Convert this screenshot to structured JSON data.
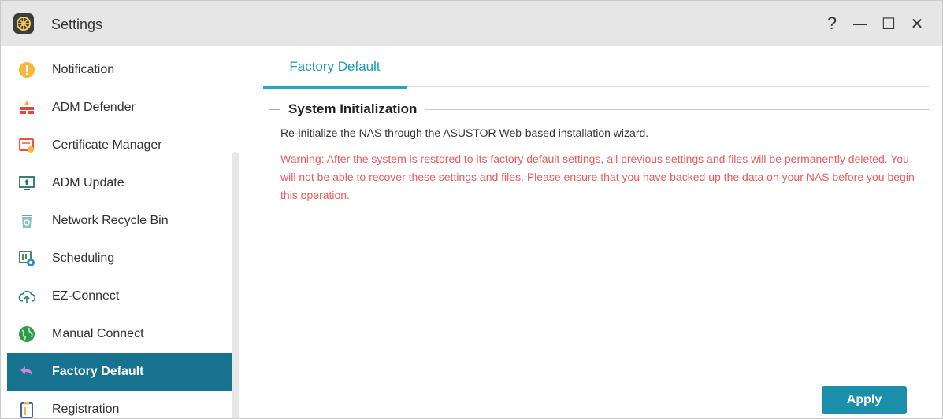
{
  "window": {
    "title": "Settings",
    "help_glyph": "?",
    "minimize_glyph": "—",
    "maximize_glyph": "☐",
    "close_glyph": "✕"
  },
  "sidebar": {
    "items": [
      {
        "label": "Notification",
        "icon": "exclamation-circle-icon",
        "active": false
      },
      {
        "label": "ADM Defender",
        "icon": "firewall-icon",
        "active": false
      },
      {
        "label": "Certificate Manager",
        "icon": "certificate-icon",
        "active": false
      },
      {
        "label": "ADM Update",
        "icon": "monitor-update-icon",
        "active": false
      },
      {
        "label": "Network Recycle Bin",
        "icon": "recycle-bin-icon",
        "active": false
      },
      {
        "label": "Scheduling",
        "icon": "scheduling-icon",
        "active": false
      },
      {
        "label": "EZ-Connect",
        "icon": "cloud-upload-icon",
        "active": false
      },
      {
        "label": "Manual Connect",
        "icon": "globe-icon",
        "active": false
      },
      {
        "label": "Factory Default",
        "icon": "undo-arrow-icon",
        "active": true
      },
      {
        "label": "Registration",
        "icon": "clipboard-icon",
        "active": false
      }
    ]
  },
  "main": {
    "tab_label": "Factory Default",
    "section_title": "System Initialization",
    "description": "Re-initialize the NAS through the ASUSTOR Web-based installation wizard.",
    "warning": "Warning: After the system is restored to its factory default settings, all previous settings and files will be permanently deleted. You will not be able to recover these settings and files. Please ensure that you have backed up the data on your NAS before you begin this operation.",
    "apply_label": "Apply"
  },
  "colors": {
    "accent": "#16728f",
    "tab_text": "#1a9ab7",
    "warning_text": "#ef5a5a",
    "apply_button": "#1b8fa9"
  }
}
